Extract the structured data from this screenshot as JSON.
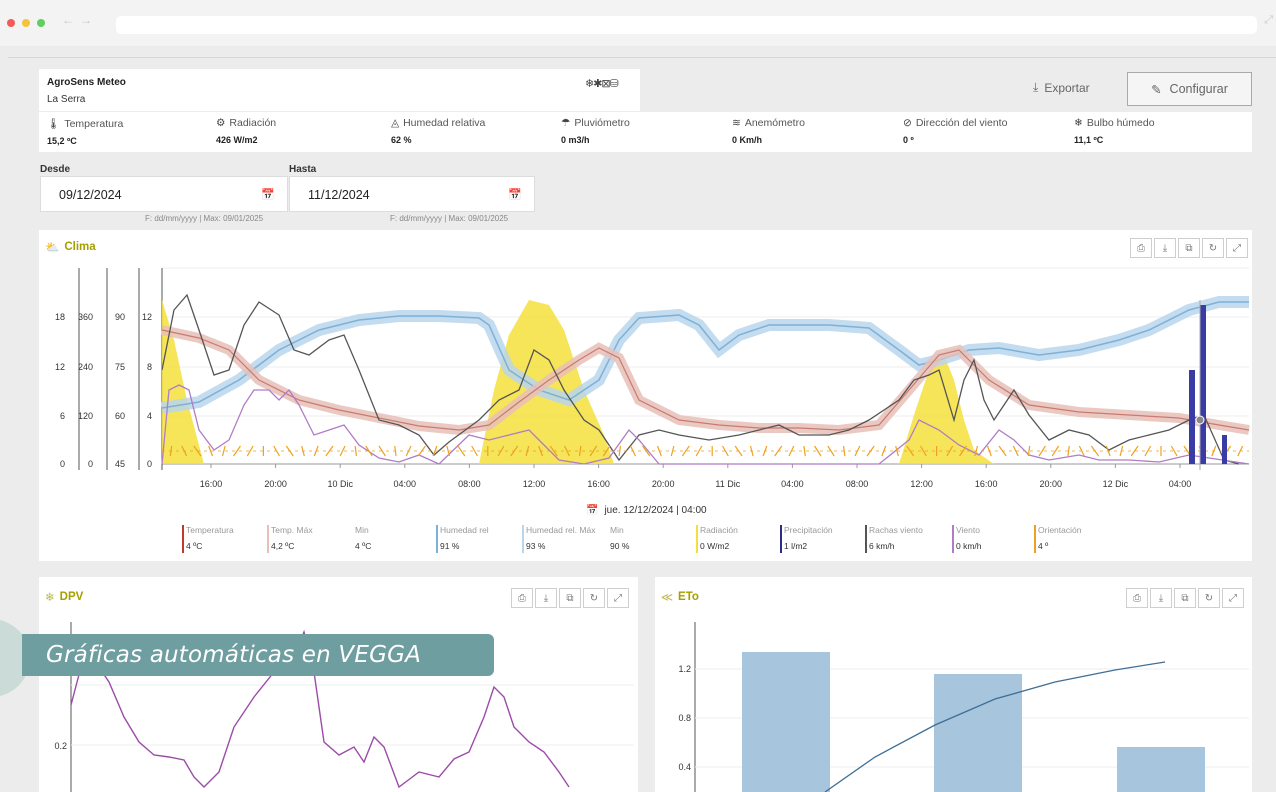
{
  "station": {
    "name": "AgroSens Meteo",
    "place": "La Serra",
    "icons": "❄✱⊠⛁"
  },
  "actions": {
    "export_label": "Exportar",
    "configure_label": "Configurar"
  },
  "sensors": [
    {
      "icon": "thermometer-icon",
      "glyph": "🌡",
      "label": "Temperatura",
      "value": "15,2 ºC"
    },
    {
      "icon": "radiation-icon",
      "glyph": "⚙",
      "label": "Radiación",
      "value": "426 W/m2"
    },
    {
      "icon": "humidity-icon",
      "glyph": "💧",
      "label": "Humedad relativa",
      "value": "62 %"
    },
    {
      "icon": "rain-gauge-icon",
      "glyph": "☂",
      "label": "Pluviómetro",
      "value": "0 m3/h"
    },
    {
      "icon": "anemometer-icon",
      "glyph": "≋",
      "label": "Anemómetro",
      "value": "0 Km/h"
    },
    {
      "icon": "wind-direction-icon",
      "glyph": "⊘",
      "label": "Dirección del viento",
      "value": "0 º"
    },
    {
      "icon": "wet-bulb-icon",
      "glyph": "❄",
      "label": "Bulbo húmedo",
      "value": "11,1 ºC"
    }
  ],
  "dates": {
    "from_label": "Desde",
    "from_value": "09/12/2024",
    "from_hint": "F: dd/mm/yyyy | Max: 09/01/2025",
    "to_label": "Hasta",
    "to_value": "11/12/2024",
    "to_hint": "F: dd/mm/yyyy | Max: 09/01/2025"
  },
  "clima": {
    "title": "Clima",
    "timestamp": "jue. 12/12/2024 | 04:00",
    "y_axes": [
      {
        "ticks": [
          "18",
          "12",
          "6",
          "0"
        ]
      },
      {
        "ticks": [
          "360",
          "240",
          "120",
          "0"
        ]
      },
      {
        "ticks": [
          "90",
          "75",
          "60",
          "45"
        ]
      },
      {
        "ticks": [
          "12",
          "8",
          "4",
          "0"
        ]
      }
    ],
    "x_ticks": [
      "16:00",
      "20:00",
      "10 Dic",
      "04:00",
      "08:00",
      "12:00",
      "16:00",
      "20:00",
      "11 Dic",
      "04:00",
      "08:00",
      "12:00",
      "16:00",
      "20:00",
      "12 Dic",
      "04:00"
    ],
    "legend": [
      {
        "name": "Temperatura",
        "value": "4 ºC",
        "color": "#c0392b"
      },
      {
        "name": "Temp. Máx",
        "value": "4,2 ºC",
        "color": "#e8bfb8",
        "sub_name": "Min",
        "sub_value": "4 ºC"
      },
      {
        "name": "Humedad rel",
        "value": "91 %",
        "color": "#7fb0d6"
      },
      {
        "name": "Humedad rel. Máx",
        "value": "93 %",
        "color": "#b9d6ec",
        "sub_name": "Min",
        "sub_value": "90 %"
      },
      {
        "name": "Radiación",
        "value": "0 W/m2",
        "color": "#f4df3c"
      },
      {
        "name": "Precipitación",
        "value": "1 l/m2",
        "color": "#2c2c8c"
      },
      {
        "name": "Rachas viento",
        "value": "6 km/h",
        "color": "#555555"
      },
      {
        "name": "Viento",
        "value": "0 km/h",
        "color": "#b07cc6"
      },
      {
        "name": "Orientación",
        "value": "4 º",
        "color": "#f0a020"
      }
    ]
  },
  "dpv": {
    "title": "DPV",
    "y_ticks": [
      "0.2"
    ]
  },
  "eto": {
    "title": "ETo",
    "y_ticks": [
      "1.2",
      "0.8",
      "0.4"
    ]
  },
  "caption": "Gráficas automáticas en VEGGA",
  "colors": {
    "accent": "#a5a000",
    "caption_bg": "#6f9ea0"
  }
}
